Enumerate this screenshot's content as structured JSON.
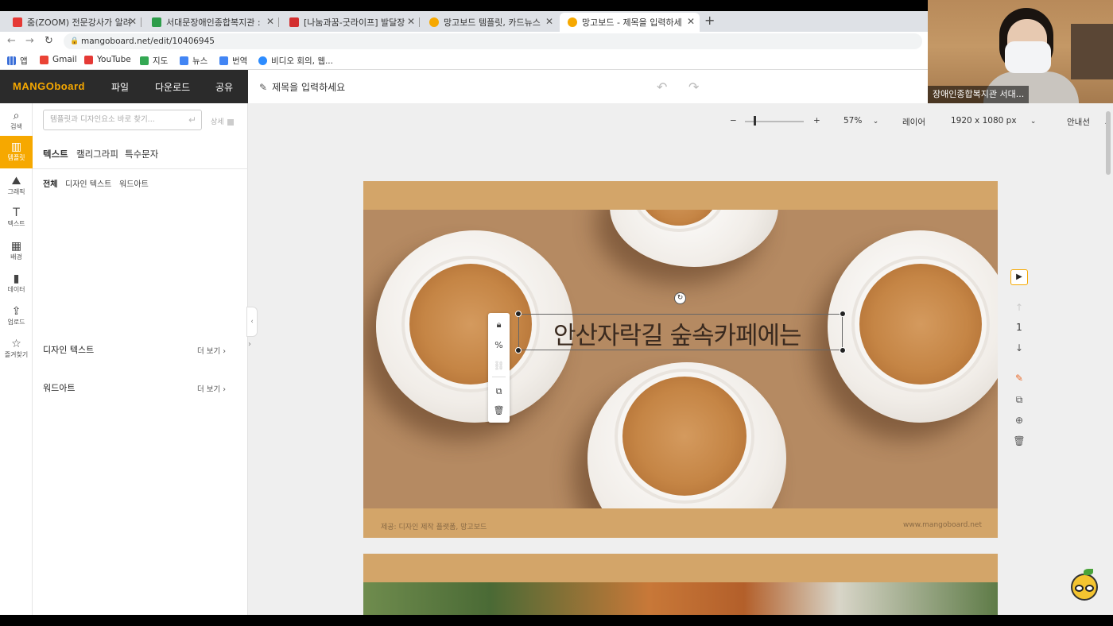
{
  "browser": {
    "tabs": [
      {
        "label": "줌(ZOOM) 전문강사가 알려",
        "color": "#e53935",
        "active": false
      },
      {
        "label": "서대문장애인종합복지관 : ",
        "color": "#2e9d4a",
        "active": false
      },
      {
        "label": "[나눔과꿈-굿라이프] 발달장",
        "color": "#d32f2f",
        "active": false
      },
      {
        "label": "망고보드 템플릿, 카드뉴스",
        "color": "#f6a800",
        "active": false
      },
      {
        "label": "망고보드 - 제목을 입력하세",
        "color": "#f6a800",
        "active": true
      }
    ],
    "new_tab": "+",
    "url": "mangoboard.net/edit/10406945",
    "bookmarks": [
      {
        "label": "앱",
        "color": "#3b6fd8"
      },
      {
        "label": "Gmail",
        "color": "#ea4335"
      },
      {
        "label": "YouTube",
        "color": "#e53935"
      },
      {
        "label": "지도",
        "color": "#34a853"
      },
      {
        "label": "뉴스",
        "color": "#4285f4"
      },
      {
        "label": "번역",
        "color": "#4285f4"
      },
      {
        "label": "비디오 회의, 웹...",
        "color": "#2d8cff"
      }
    ]
  },
  "app": {
    "logo": "MANGOboard",
    "menu": [
      "파일",
      "다운로드",
      "공유"
    ],
    "title_placeholder": "제목을 입력하세요",
    "accent": "#f6a800"
  },
  "webcam": {
    "caption": "장애인종합복지관 서대..."
  },
  "rail": [
    {
      "label": "검색",
      "icon": "⌕",
      "name": "search"
    },
    {
      "label": "템플릿",
      "icon": "▥",
      "name": "template"
    },
    {
      "label": "그래픽",
      "icon": "⛰",
      "name": "graphic"
    },
    {
      "label": "텍스트",
      "icon": "T",
      "name": "text"
    },
    {
      "label": "배경",
      "icon": "▦",
      "name": "background"
    },
    {
      "label": "데이터",
      "icon": "▮",
      "name": "data"
    },
    {
      "label": "업로드",
      "icon": "⇪",
      "name": "upload"
    },
    {
      "label": "즐겨찾기",
      "icon": "☆",
      "name": "favorites"
    }
  ],
  "panel": {
    "search_placeholder": "템플릿과 디자인요소 바로 찾기...",
    "search_enter": "↵",
    "detail": "상세",
    "tabs": [
      "텍스트",
      "캘리그라피",
      "특수문자"
    ],
    "subtabs": [
      "전체",
      "디자인 텍스트",
      "워드아트"
    ],
    "sections": [
      {
        "title": "디자인 텍스트",
        "more": "더 보기"
      },
      {
        "title": "워드아트",
        "more": "더 보기"
      }
    ]
  },
  "toolbar": {
    "zoom_minus": "−",
    "zoom_plus": "+",
    "zoom_level": "57%",
    "layer": "레이어",
    "canvas_size": "1920 x 1080 px",
    "guide": "안내선"
  },
  "slide": {
    "text": "안산자락길 숲속카페에는",
    "footer_left": "제공: 디자인 제작 플랫폼, 망고보드",
    "footer_right": "www.mangoboard.net"
  },
  "right_tools": {
    "page_number": "1"
  }
}
